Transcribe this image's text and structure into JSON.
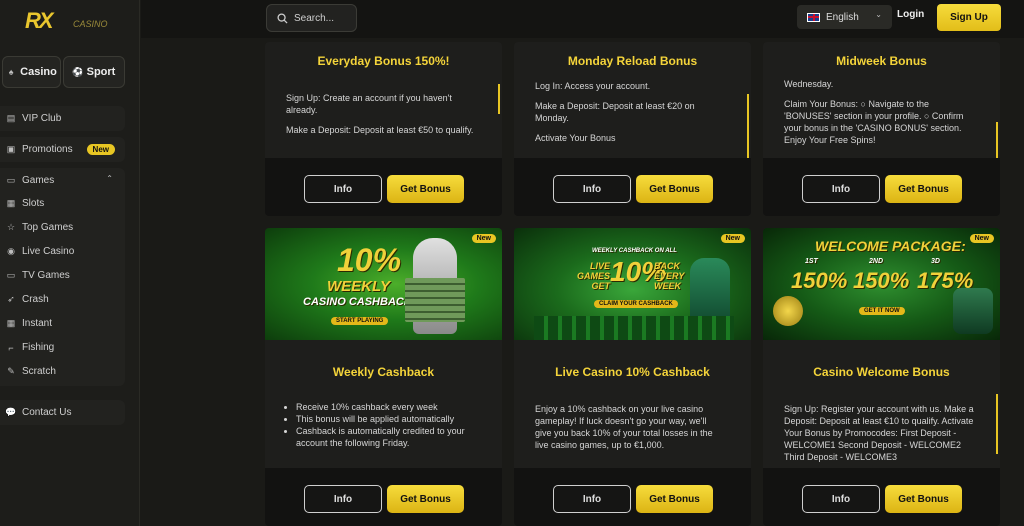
{
  "brand": {
    "logo_text": "RX",
    "logo_sub": "CASINO"
  },
  "sidebar": {
    "tabs": [
      {
        "label": "Casino",
        "icon": "spade-icon"
      },
      {
        "label": "Sport",
        "icon": "soccer-ball-icon"
      }
    ],
    "vip": "VIP Club",
    "promotions": {
      "label": "Promotions",
      "badge": "New"
    },
    "games": {
      "label": "Games",
      "items": [
        "Slots",
        "Top Games",
        "Live Casino",
        "TV Games",
        "Crash",
        "Instant",
        "Fishing",
        "Scratch"
      ]
    },
    "contact": "Contact Us"
  },
  "header": {
    "search_placeholder": "Search...",
    "language": "English",
    "login": "Login",
    "signup": "Sign Up"
  },
  "buttons": {
    "info": "Info",
    "get": "Get Bonus"
  },
  "cards_top": [
    {
      "title": "Everyday Bonus 150%!",
      "paras": [
        "Sign Up: Create an account if you haven't already.",
        "Make a Deposit: Deposit at least €50 to qualify."
      ]
    },
    {
      "title": "Monday Reload Bonus",
      "paras": [
        "Log In: Access your account.",
        "Make a Deposit: Deposit at least €20 on Monday.",
        "Activate Your Bonus"
      ]
    },
    {
      "title": "Midweek Bonus",
      "paras": [
        "Wednesday.",
        "Claim Your Bonus: ○ Navigate to the 'BONUSES' section in your profile. ○ Confirm your bonus in the 'CASINO BONUS' section. Enjoy Your Free Spins!"
      ]
    }
  ],
  "cards_bottom": [
    {
      "title": "Weekly Cashback",
      "badge": "New",
      "banner": {
        "l1": "10%",
        "l2": "WEEKLY",
        "l3": "CASINO CASHBACK",
        "btn": "START PLAYING"
      },
      "list": [
        "Receive 10% cashback every week",
        "This bonus will be applied automatically",
        "Cashback is automatically credited to your account the following Friday."
      ]
    },
    {
      "title": "Live Casino 10% Cashback",
      "badge": "New",
      "banner": {
        "top": "WEEKLY CASHBACK ON ALL",
        "l1": "LIVE GAMES GET",
        "big": "10%",
        "l2": "BACK EVERY WEEK",
        "btn": "CLAIM YOUR CASHBACK"
      },
      "text": "Enjoy a 10% cashback on your live casino gameplay! If luck doesn't go your way, we'll give you back 10% of your total losses in the live casino games, up to €1,000."
    },
    {
      "title": "Casino Welcome Bonus",
      "badge": "New",
      "banner": {
        "head": "WELCOME PACKAGE:",
        "tiers": [
          {
            "n": "1ST",
            "v": "150%"
          },
          {
            "n": "2ND",
            "v": "150%"
          },
          {
            "n": "3D",
            "v": "175%"
          }
        ],
        "btn": "GET IT NOW"
      },
      "text": "Sign Up: Register your account with us. Make a Deposit: Deposit at least €10 to qualify. Activate Your Bonus by Promocodes: First Deposit - WELCOME1 Second Deposit - WELCOME2 Third Deposit - WELCOME3"
    }
  ],
  "colors": {
    "accent": "#e8c623",
    "bg": "#1a1a17",
    "card": "#1e1e1c"
  }
}
